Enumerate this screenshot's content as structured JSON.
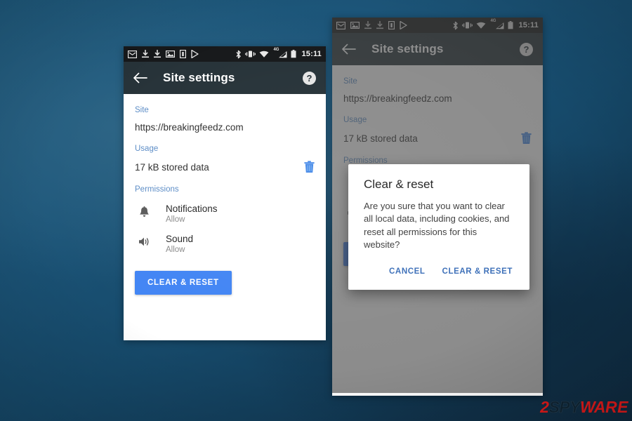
{
  "statusbar": {
    "time": "15:11",
    "left_icons": [
      "mail-icon",
      "download-icon",
      "download-icon",
      "image-icon",
      "device-icon",
      "play-store-icon"
    ],
    "right_icons": [
      "bluetooth-icon",
      "vibrate-icon",
      "wifi-icon",
      "signal-icon",
      "battery-icon"
    ],
    "network_label": "4G"
  },
  "appbar": {
    "back_icon": "back-arrow-icon",
    "title": "Site settings",
    "help_label": "?"
  },
  "page": {
    "site_label": "Site",
    "site_url": "https://breakingfeedz.com",
    "usage_label": "Usage",
    "usage_value": "17 kB stored data",
    "delete_icon": "trash-icon",
    "permissions_label": "Permissions",
    "permissions": [
      {
        "icon": "bell-icon",
        "title": "Notifications",
        "state": "Allow"
      },
      {
        "icon": "speaker-icon",
        "title": "Sound",
        "state": "Allow"
      }
    ],
    "clear_reset_label": "CLEAR & RESET"
  },
  "dialog": {
    "title": "Clear & reset",
    "message": "Are you sure that you want to clear all local data, including cookies, and reset all permissions for this website?",
    "cancel_label": "CANCEL",
    "confirm_label": "CLEAR & RESET"
  },
  "watermark": {
    "part1": "2",
    "part2": "SPY",
    "part3": "WAR",
    "part4": "E"
  },
  "colors": {
    "accent_blue": "#4285f4",
    "appbar": "#263238",
    "statusbar": "#16181a",
    "label_blue": "#5b8cc6",
    "dialog_action": "#3c6fb8",
    "watermark_red": "#e01a1a"
  }
}
